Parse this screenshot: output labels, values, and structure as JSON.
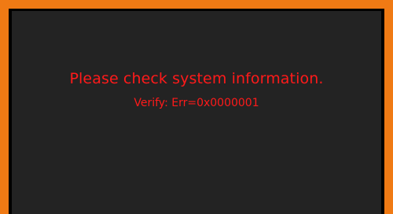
{
  "screen": {
    "message": "Please check system information.",
    "error_line": "Verify: Err=0x0000001"
  },
  "colors": {
    "frame": "#f07a14",
    "background": "#232323",
    "text": "#ff1a1a"
  }
}
